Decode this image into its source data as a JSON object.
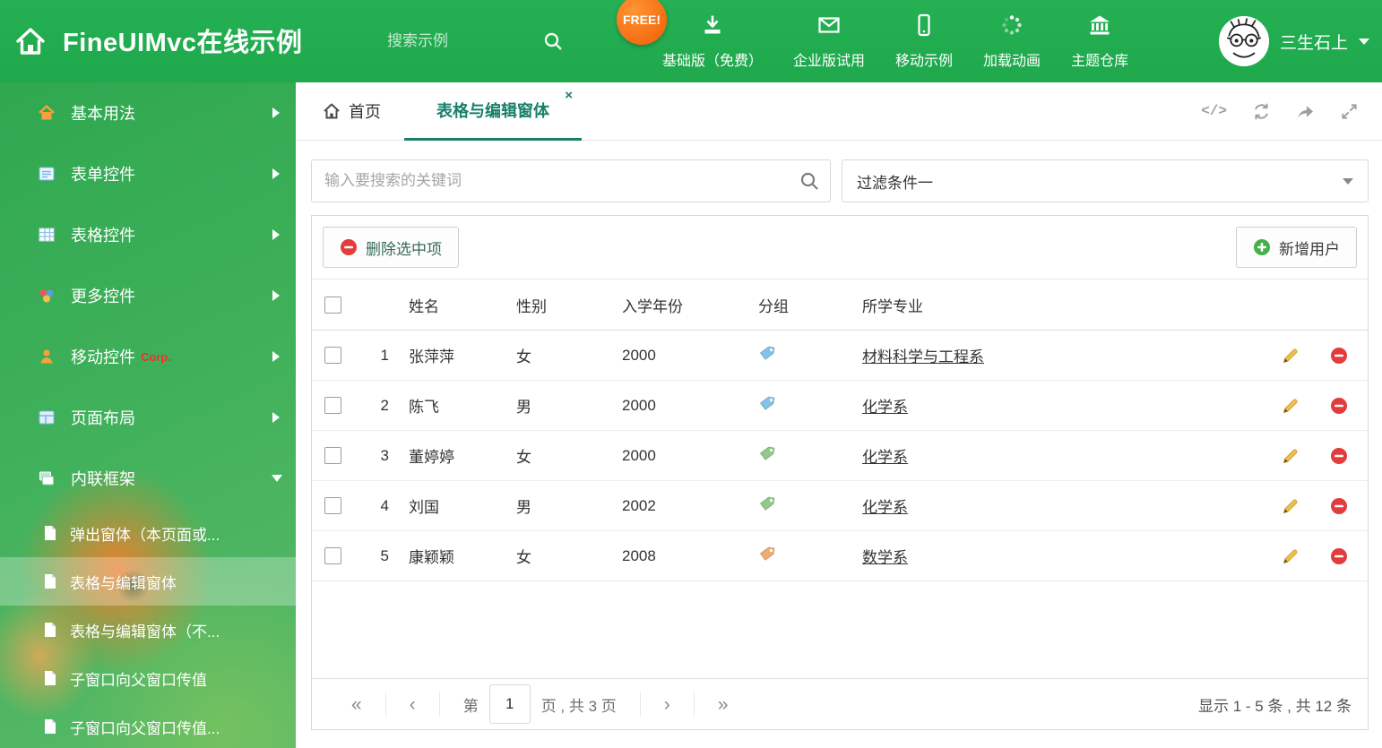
{
  "header": {
    "title": "FineUIMvc在线示例",
    "search_placeholder": "搜索示例",
    "free_badge": "FREE!",
    "nav_items": [
      {
        "icon": "download",
        "label": "基础版（免费）"
      },
      {
        "icon": "mail",
        "label": "企业版试用"
      },
      {
        "icon": "mobile",
        "label": "移动示例"
      },
      {
        "icon": "spinner",
        "label": "加载动画"
      },
      {
        "icon": "bank",
        "label": "主题仓库"
      }
    ],
    "user_name": "三生石上"
  },
  "sidebar": {
    "items": [
      {
        "icon": "home",
        "label": "基本用法"
      },
      {
        "icon": "form",
        "label": "表单控件"
      },
      {
        "icon": "table",
        "label": "表格控件"
      },
      {
        "icon": "widgets",
        "label": "更多控件"
      },
      {
        "icon": "mobilectl",
        "label": "移动控件",
        "badge": "Corp."
      },
      {
        "icon": "layout",
        "label": "页面布局"
      },
      {
        "icon": "frame",
        "label": "内联框架",
        "expanded": true
      }
    ],
    "subitems": [
      {
        "label": "弹出窗体（本页面或..."
      },
      {
        "label": "表格与编辑窗体",
        "active": true
      },
      {
        "label": "表格与编辑窗体（不..."
      },
      {
        "label": "子窗口向父窗口传值"
      },
      {
        "label": "子窗口向父窗口传值..."
      }
    ]
  },
  "tabs": {
    "home_label": "首页",
    "active_label": "表格与编辑窗体",
    "close_glyph": "×",
    "code_glyph": "</>"
  },
  "filters": {
    "search_placeholder": "输入要搜索的关键词",
    "dropdown_value": "过滤条件一"
  },
  "toolbar": {
    "delete_label": "删除选中项",
    "add_label": "新增用户"
  },
  "table": {
    "columns": {
      "name": "姓名",
      "gender": "性别",
      "year": "入学年份",
      "group": "分组",
      "major": "所学专业"
    },
    "rows": [
      {
        "num": "1",
        "name": "张萍萍",
        "gender": "女",
        "year": "2000",
        "tag_color": "#7fc4e9",
        "major": "材料科学与工程系"
      },
      {
        "num": "2",
        "name": "陈飞",
        "gender": "男",
        "year": "2000",
        "tag_color": "#7fc4e9",
        "major": "化学系"
      },
      {
        "num": "3",
        "name": "董婷婷",
        "gender": "女",
        "year": "2000",
        "tag_color": "#8fcb85",
        "major": "化学系"
      },
      {
        "num": "4",
        "name": "刘国",
        "gender": "男",
        "year": "2002",
        "tag_color": "#8fcb85",
        "major": "化学系"
      },
      {
        "num": "5",
        "name": "康颖颖",
        "gender": "女",
        "year": "2008",
        "tag_color": "#f4ab6c",
        "major": "数学系"
      }
    ]
  },
  "pagination": {
    "first_glyph": "«",
    "prev_glyph": "‹",
    "next_glyph": "›",
    "last_glyph": "»",
    "page_prefix": "第",
    "current_page": "1",
    "page_suffix": "页 , 共 3 页",
    "summary": "显示 1 - 5 条 , 共 12 条"
  },
  "colors": {
    "header_green": "#23ad51",
    "active_teal": "#17806b",
    "free_orange": "#f25d06",
    "delete_red": "#e23c3c",
    "add_green": "#43b14b"
  }
}
